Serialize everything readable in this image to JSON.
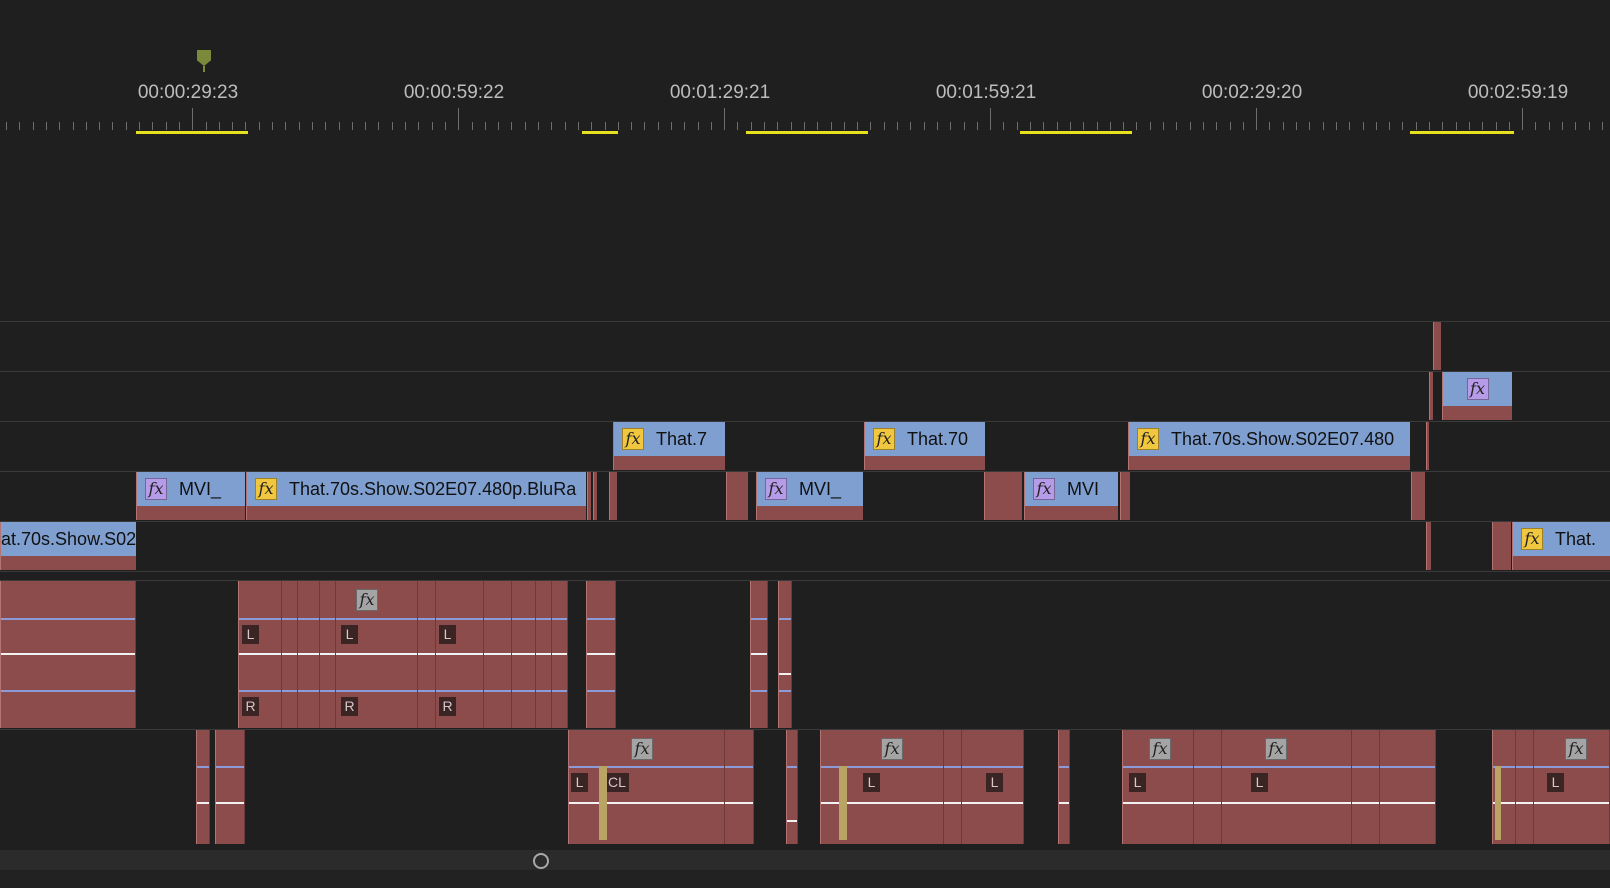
{
  "ruler": {
    "timecodes": [
      "00:00:29:23",
      "00:00:59:22",
      "00:01:29:21",
      "00:01:59:21",
      "00:02:29:20",
      "00:02:59:19"
    ]
  },
  "colors": {
    "clip_body": "#8b4c4b",
    "clip_header": "#7f9fd1",
    "fx_video": "#f0c73e",
    "fx_nested": "#b69be8",
    "fx_audio": "#a4a4a4",
    "work_area": "#e6e01e",
    "playhead": "#7a8a3a"
  },
  "video_clips": {
    "v3_a": "That.7",
    "v3_b": "That.70",
    "v3_c": "That.70s.Show.S02E07.480",
    "v2_a": "MVI_",
    "v2_b": "That.70s.Show.S02E07.480p.BluRa",
    "v2_c": "MVI_",
    "v2_d": "MVI",
    "v1_a": "at.70s.Show.S02",
    "v1_b": "That."
  },
  "audio": {
    "left": "L",
    "right": "R",
    "cl": "CL"
  },
  "icons": {
    "fx": "fx"
  }
}
